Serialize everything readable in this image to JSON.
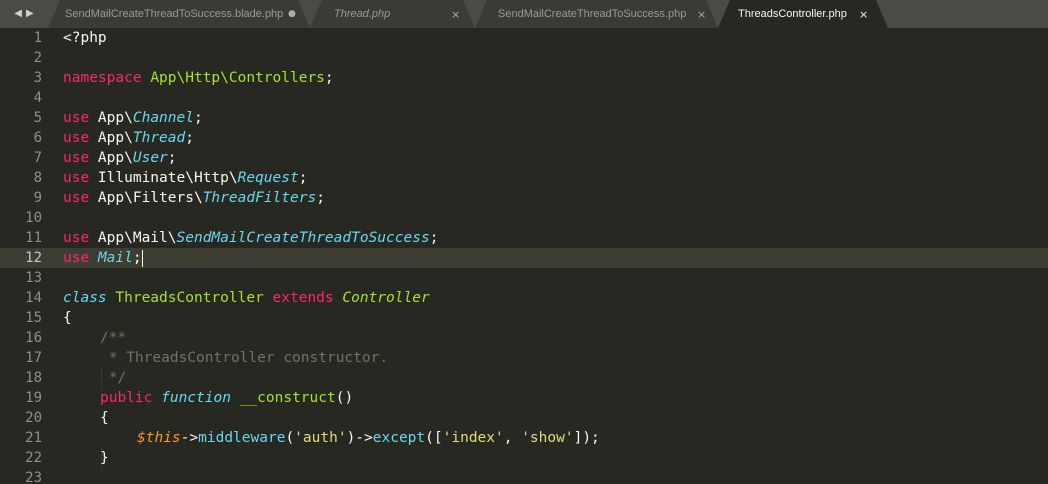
{
  "tabs": [
    {
      "label": "SendMailCreateThreadToSuccess.blade.php",
      "indicator": "●",
      "italic": false,
      "active": false
    },
    {
      "label": "Thread.php",
      "indicator": "×",
      "italic": true,
      "active": false
    },
    {
      "label": "SendMailCreateThreadToSuccess.php",
      "indicator": "×",
      "italic": false,
      "active": false
    },
    {
      "label": "ThreadsController.php",
      "indicator": "×",
      "italic": false,
      "active": true
    }
  ],
  "nav": {
    "back": "◀",
    "forward": "▶"
  },
  "current_line": 12,
  "line_numbers": [
    "1",
    "2",
    "3",
    "4",
    "5",
    "6",
    "7",
    "8",
    "9",
    "10",
    "11",
    "12",
    "13",
    "14",
    "15",
    "16",
    "17",
    "18",
    "19",
    "20",
    "21",
    "22",
    "23"
  ],
  "code": {
    "l1": [
      "<?php"
    ],
    "l3": [
      "namespace",
      " ",
      "App\\Http\\Controllers",
      ";"
    ],
    "l5": [
      "use",
      " App\\",
      "Channel",
      ";"
    ],
    "l6": [
      "use",
      " App\\",
      "Thread",
      ";"
    ],
    "l7": [
      "use",
      " App\\",
      "User",
      ";"
    ],
    "l8": [
      "use",
      " Illuminate\\Http\\",
      "Request",
      ";"
    ],
    "l9": [
      "use",
      " App\\Filters\\",
      "ThreadFilters",
      ";"
    ],
    "l11": [
      "use",
      " App\\Mail\\",
      "SendMailCreateThreadToSuccess",
      ";"
    ],
    "l12": [
      "use",
      " ",
      "Mail",
      ";"
    ],
    "l14": [
      "class",
      " ",
      "ThreadsController",
      " ",
      "extends",
      " ",
      "Controller"
    ],
    "l15": [
      "{"
    ],
    "l16": [
      "/**"
    ],
    "l17": [
      " * ThreadsController constructor."
    ],
    "l18": [
      " */"
    ],
    "l19": [
      "public",
      " ",
      "function",
      " ",
      "__construct",
      "()"
    ],
    "l20": [
      "{"
    ],
    "l21": [
      "$this",
      "->",
      "middleware",
      "(",
      "'auth'",
      ")->",
      "except",
      "([",
      "'index'",
      ", ",
      "'show'",
      "]);"
    ],
    "l22": [
      "}"
    ]
  },
  "colors": {
    "background": "#272822",
    "tabbar": "#4a4b45",
    "keyword": "#f92672",
    "type": "#66d9ef",
    "entity": "#a6e22e",
    "string": "#e6db74",
    "comment": "#75715e",
    "variable": "#fd971f"
  }
}
